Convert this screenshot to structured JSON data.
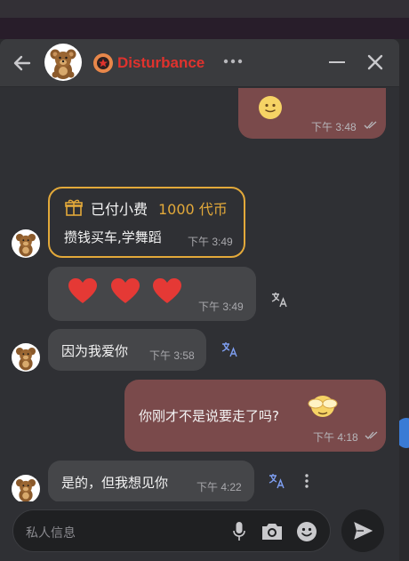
{
  "chat": {
    "name": "Disturbance",
    "name_color": "#e0322d"
  },
  "messages": [
    {
      "id": "m1",
      "direction": "out",
      "content": "emoji-smile",
      "time": "下午 3:48"
    },
    {
      "id": "m2",
      "direction": "in",
      "type": "gift",
      "gift_label": "已付小费",
      "gift_amount": "1000 代币",
      "text": "攒钱买车,学舞蹈",
      "time": "下午 3:49"
    },
    {
      "id": "m3",
      "direction": "in",
      "content": "hearts",
      "time": "下午 3:49"
    },
    {
      "id": "m4",
      "direction": "in",
      "text": "因为我爱你",
      "time": "下午 3:58"
    },
    {
      "id": "m5",
      "direction": "out",
      "text": "你刚才不是说要走了吗?",
      "time": "下午 4:18"
    },
    {
      "id": "m6",
      "direction": "in",
      "text": "是的，但我想见你",
      "time": "下午 4:22"
    }
  ],
  "composer": {
    "placeholder": "私人信息"
  },
  "colors": {
    "outgoing_bubble": "#7a4a4b",
    "incoming_bubble": "#454649",
    "gift_border": "#e3a93a",
    "heart": "#e53935"
  }
}
